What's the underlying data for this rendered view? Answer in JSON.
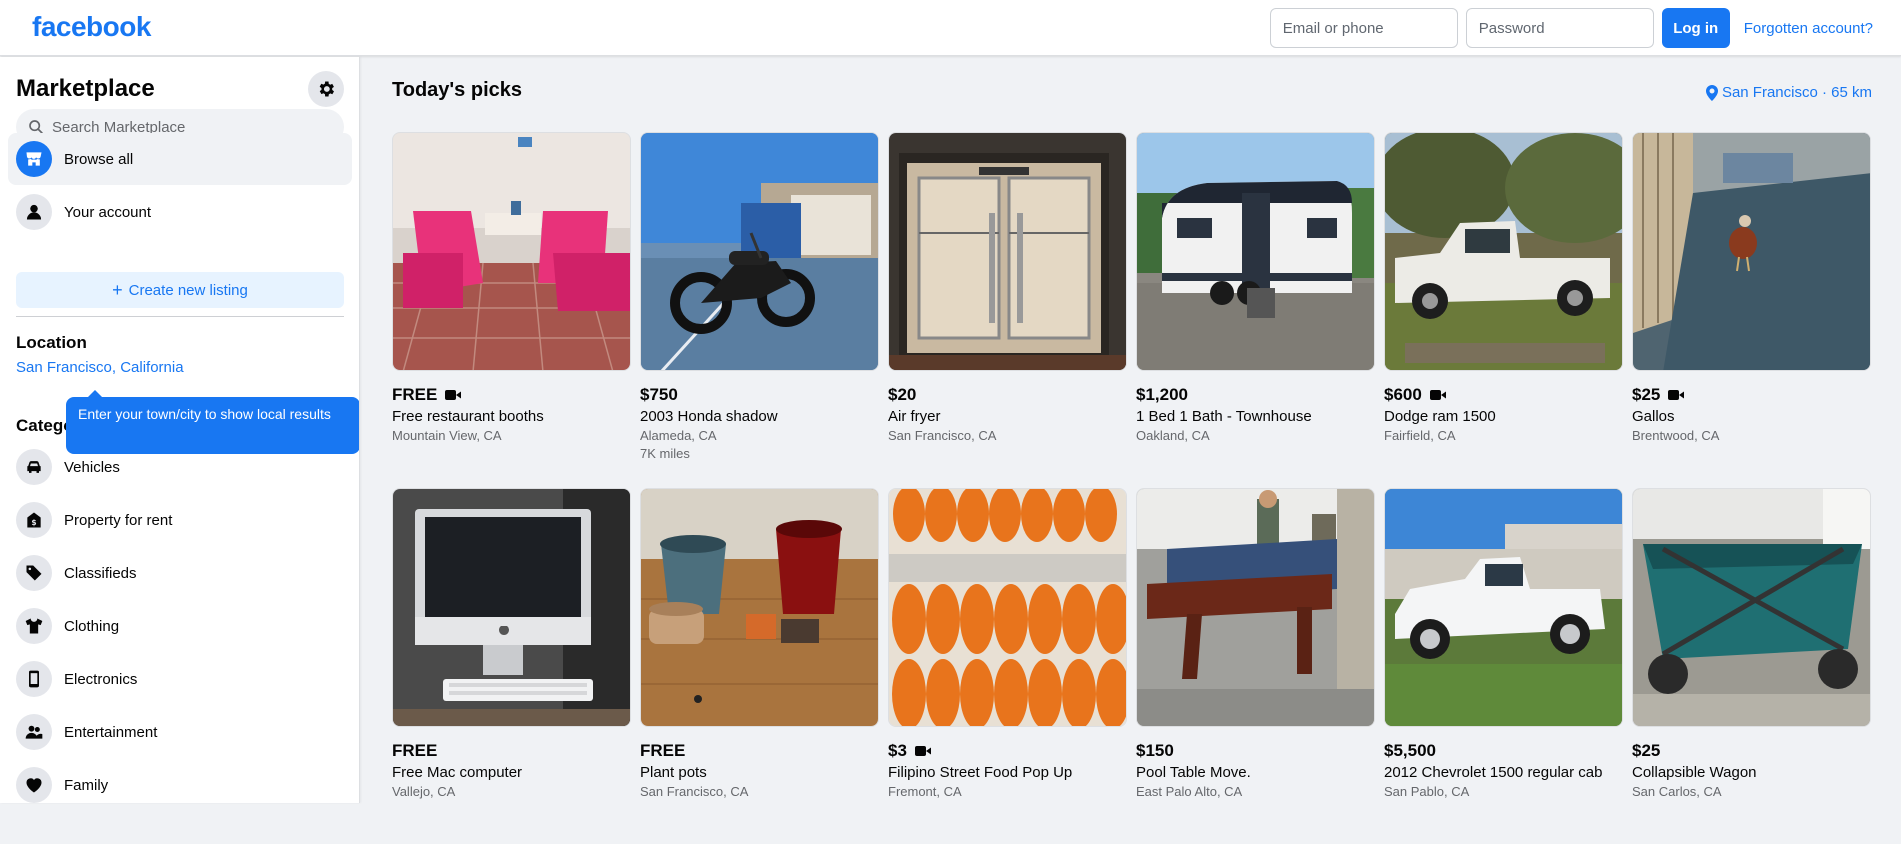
{
  "brand": {
    "logo": "facebook"
  },
  "login": {
    "email_placeholder": "Email or phone",
    "password_placeholder": "Password",
    "login_label": "Log in",
    "forgot_label": "Forgotten account?"
  },
  "sidebar": {
    "title": "Marketplace",
    "search_placeholder": "Search Marketplace",
    "nav": [
      {
        "label": "Browse all",
        "icon": "store-icon"
      },
      {
        "label": "Your account",
        "icon": "person-icon"
      }
    ],
    "create_label": "Create new listing",
    "location_title": "Location",
    "location_value": "San Francisco, California",
    "tooltip": "Enter your town/city to show local results",
    "categories_title": "Categories",
    "categories": [
      {
        "label": "Vehicles",
        "icon": "car-icon"
      },
      {
        "label": "Property for rent",
        "icon": "house-dollar-icon"
      },
      {
        "label": "Classifieds",
        "icon": "tag-icon"
      },
      {
        "label": "Clothing",
        "icon": "shirt-icon"
      },
      {
        "label": "Electronics",
        "icon": "phone-icon"
      },
      {
        "label": "Entertainment",
        "icon": "people-icon"
      },
      {
        "label": "Family",
        "icon": "heart-icon"
      }
    ]
  },
  "main": {
    "title": "Today's picks",
    "location": "San Francisco · 65 km",
    "listings": [
      {
        "price": "FREE",
        "video": true,
        "title": "Free restaurant booths",
        "place": "Mountain View, CA",
        "extra": ""
      },
      {
        "price": "$750",
        "video": false,
        "title": "2003 Honda shadow",
        "place": "Alameda, CA",
        "extra": "7K miles"
      },
      {
        "price": "$20",
        "video": false,
        "title": "Air fryer",
        "place": "San Francisco, CA",
        "extra": ""
      },
      {
        "price": "$1,200",
        "video": false,
        "title": "1 Bed 1 Bath - Townhouse",
        "place": "Oakland, CA",
        "extra": ""
      },
      {
        "price": "$600",
        "video": true,
        "title": "Dodge ram 1500",
        "place": "Fairfield, CA",
        "extra": ""
      },
      {
        "price": "$25",
        "video": true,
        "title": "Gallos",
        "place": "Brentwood, CA",
        "extra": ""
      },
      {
        "price": "FREE",
        "video": false,
        "title": "Free Mac computer",
        "place": "Vallejo, CA",
        "extra": ""
      },
      {
        "price": "FREE",
        "video": false,
        "title": "Plant pots",
        "place": "San Francisco, CA",
        "extra": ""
      },
      {
        "price": "$3",
        "video": true,
        "title": "Filipino Street Food Pop Up",
        "place": "Fremont, CA",
        "extra": ""
      },
      {
        "price": "$150",
        "video": false,
        "title": "Pool Table Move.",
        "place": "East Palo Alto, CA",
        "extra": ""
      },
      {
        "price": "$5,500",
        "video": false,
        "title": "2012 Chevrolet 1500 regular cab",
        "place": "San Pablo, CA",
        "extra": ""
      },
      {
        "price": "$25",
        "video": false,
        "title": "Collapsible Wagon",
        "place": "San Carlos, CA",
        "extra": ""
      }
    ]
  },
  "colors": {
    "accent": "#1877f2",
    "page_bg": "#f0f2f5"
  }
}
